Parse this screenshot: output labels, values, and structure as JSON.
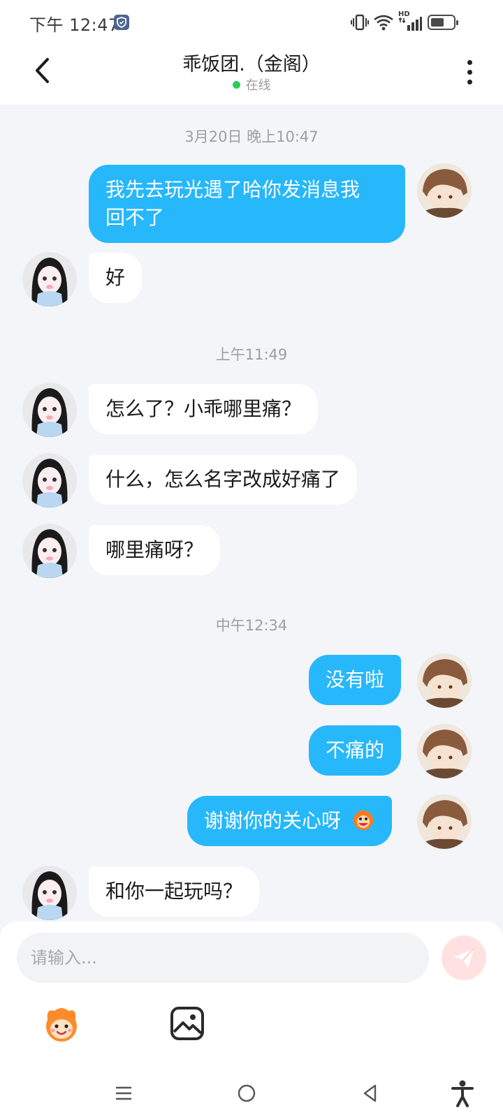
{
  "status_bar": {
    "time": "下午 12:47",
    "hd_label": "HD",
    "battery_level": 0.55,
    "icons": [
      "shield-icon",
      "vibrate-icon",
      "wifi-icon",
      "signal-icon",
      "battery-icon"
    ]
  },
  "header": {
    "title": "乖饭团.（金阁）",
    "status": "在线",
    "status_color": "#2ecc5a",
    "back_icon": "chevron-left-icon",
    "more_icon": "more-vertical-icon"
  },
  "colors": {
    "my_bubble": "#27b7fb",
    "their_bubble": "#ffffff",
    "background": "#f3f5f8",
    "send_button": "#ffe1e1"
  },
  "messages": {
    "ts1": "3月20日 晚上10:47",
    "m1_line1": "我先去玩光遇了哈你发消息我",
    "m1_line2": "回不了",
    "m2": "好",
    "ts2": "上午11:49",
    "m3": "怎么了？小乖哪里痛？",
    "m4": "什么，怎么名字改成好痛了",
    "m5": "哪里痛呀？",
    "ts3": "中午12:34",
    "m6": "没有啦",
    "m7": "不痛的",
    "m8": "谢谢你的关心呀",
    "m9": "和你一起玩吗？"
  },
  "input": {
    "placeholder": "请输入...",
    "value": "",
    "send_icon": "send-icon",
    "emoji_icon": "emoji-mascot-icon",
    "image_icon": "image-icon"
  },
  "nav": {
    "icons": [
      "menu-icon",
      "home-icon",
      "back-triangle-icon",
      "accessibility-icon"
    ]
  }
}
